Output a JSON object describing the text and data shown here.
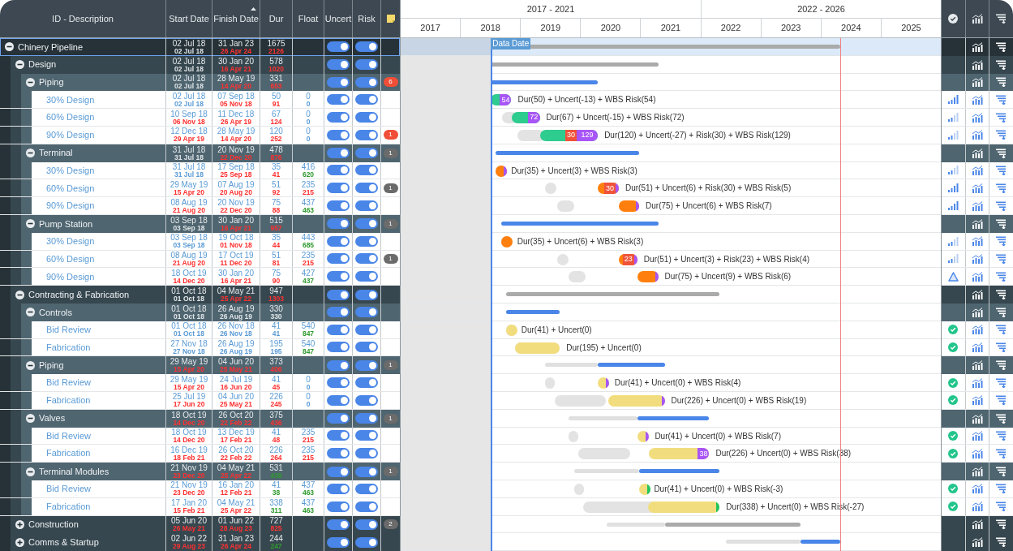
{
  "table": {
    "columns": [
      {
        "label": "ID - Description",
        "sorted": false
      },
      {
        "label": "Start Date",
        "sorted": false
      },
      {
        "label": "Finish Date",
        "sorted": true
      },
      {
        "label": "Dur",
        "sorted": false
      },
      {
        "label": "Float",
        "sorted": false
      },
      {
        "label": "Uncert",
        "sorted": false
      },
      {
        "label": "Risk",
        "sorted": false
      }
    ],
    "rows": [
      {
        "kind": "group",
        "name": "Chinery Pipeline",
        "expanded": true,
        "selected": true,
        "color": "#aaaaaa",
        "start": {
          "planned": "02 Jul 18",
          "risked": "02 Jul 18",
          "color": "#dfe5e8"
        },
        "finish": {
          "planned": "31 Jan 23",
          "risked": "26 Apr 24",
          "color": "#ff3030"
        },
        "dur": {
          "planned": "1675",
          "risked": "2126",
          "color": "#ff3030"
        },
        "uncert_on": true,
        "risk_on": true,
        "children": [
          {
            "kind": "group",
            "name": "Design",
            "expanded": true,
            "selected": false,
            "color": "#aaaaaa",
            "start": {
              "planned": "02 Jul 18",
              "risked": "02 Jul 18",
              "color": "#dfe5e8"
            },
            "finish": {
              "planned": "30 Jan 20",
              "risked": "16 Apr 21",
              "color": "#ff3030"
            },
            "dur": {
              "planned": "578",
              "risked": "1020",
              "color": "#ff3030"
            },
            "uncert_on": true,
            "risk_on": true,
            "children": [
              {
                "kind": "group",
                "name": "Piping",
                "expanded": true,
                "selected": false,
                "color": "#4a86e8",
                "start": {
                  "planned": "02 Jul 18",
                  "risked": "02 Jul 18",
                  "color": "#dfe5e8"
                },
                "finish": {
                  "planned": "28 May 19",
                  "risked": "14 Apr 20",
                  "color": "#ff3030"
                },
                "dur": {
                  "planned": "331",
                  "risked": "653",
                  "color": "#ff3030"
                },
                "uncert_on": true,
                "risk_on": true,
                "notes": {
                  "count": "6",
                  "urgent": true
                },
                "children": [
                  {
                    "kind": "task",
                    "name": "30% Design",
                    "selected": false,
                    "color": "#2ecc8f",
                    "start": {
                      "planned": "02 Jul 18",
                      "risked": "02 Jul 18",
                      "color": "#5b9bd5"
                    },
                    "finish": {
                      "planned": "07 Sep 18",
                      "risked": "05 Nov 18",
                      "color": "#ff3030"
                    },
                    "dur": {
                      "planned": "50",
                      "risked": "91",
                      "color": "#ff3030"
                    },
                    "float": {
                      "planned": "0",
                      "risked": "0",
                      "color": "#5b9bd5"
                    },
                    "uncert_on": true,
                    "risk_on": true,
                    "segments": [
                      {
                        "kind": "wbs_risk",
                        "label": "54"
                      }
                    ],
                    "annotation": "Dur(50) + Uncert(-13) + WBS Risk(54)",
                    "status": {
                      "kind": "signal",
                      "strong": true
                    }
                  },
                  {
                    "kind": "task",
                    "name": "60% Design",
                    "selected": false,
                    "color": "#2ecc8f",
                    "start": {
                      "planned": "10 Sep 18",
                      "risked": "06 Nov 18",
                      "color": "#ff3030"
                    },
                    "finish": {
                      "planned": "11 Dec 18",
                      "risked": "26 Apr 19",
                      "color": "#ff3030"
                    },
                    "dur": {
                      "planned": "67",
                      "risked": "124",
                      "color": "#ff3030"
                    },
                    "float": {
                      "planned": "0",
                      "risked": "0",
                      "color": "#5b9bd5"
                    },
                    "uncert_on": true,
                    "risk_on": true,
                    "segments": [
                      {
                        "kind": "wbs_risk",
                        "label": "72"
                      }
                    ],
                    "annotation": "Dur(67) + Uncert(-15) + WBS Risk(72)",
                    "status": {
                      "kind": "signal",
                      "strong": false
                    }
                  },
                  {
                    "kind": "task",
                    "name": "90% Design",
                    "selected": false,
                    "color": "#2ecc8f",
                    "start": {
                      "planned": "12 Dec 18",
                      "risked": "29 Apr 19",
                      "color": "#ff3030"
                    },
                    "finish": {
                      "planned": "28 May 19",
                      "risked": "14 Apr 20",
                      "color": "#ff3030"
                    },
                    "dur": {
                      "planned": "120",
                      "risked": "252",
                      "color": "#ff3030"
                    },
                    "float": {
                      "planned": "0",
                      "risked": "0",
                      "color": "#5b9bd5"
                    },
                    "uncert_on": true,
                    "risk_on": true,
                    "notes": {
                      "count": "1",
                      "urgent": true
                    },
                    "segments": [
                      {
                        "kind": "risk",
                        "label": "30"
                      },
                      {
                        "kind": "wbs_risk",
                        "label": "129"
                      }
                    ],
                    "annotation": "Dur(120) + Uncert(-27) + Risk(30) + WBS Risk(129)",
                    "status": {
                      "kind": "signal",
                      "strong": false
                    }
                  }
                ]
              },
              {
                "kind": "group",
                "name": "Terminal",
                "expanded": true,
                "selected": false,
                "color": "#4a86e8",
                "start": {
                  "planned": "31 Jul 18",
                  "risked": "31 Jul 18",
                  "color": "#dfe5e8"
                },
                "finish": {
                  "planned": "20 Nov 19",
                  "risked": "22 Dec 20",
                  "color": "#ff3030"
                },
                "dur": {
                  "planned": "478",
                  "risked": "876",
                  "color": "#ff3030"
                },
                "uncert_on": true,
                "risk_on": true,
                "notes": {
                  "count": "1",
                  "urgent": false
                },
                "children": [
                  {
                    "kind": "task",
                    "name": "30% Design",
                    "selected": false,
                    "color": "#ff7f0e",
                    "start": {
                      "planned": "31 Jul 18",
                      "risked": "31 Jul 18",
                      "color": "#5b9bd5"
                    },
                    "finish": {
                      "planned": "17 Sep 18",
                      "risked": "25 Sep 18",
                      "color": "#ff3030"
                    },
                    "dur": {
                      "planned": "35",
                      "risked": "41",
                      "color": "#ff3030"
                    },
                    "float": {
                      "planned": "416",
                      "risked": "620",
                      "color": "#2f9a2f"
                    },
                    "uncert_on": true,
                    "risk_on": true,
                    "segments": [
                      {
                        "kind": "wbs_risk"
                      }
                    ],
                    "annotation": "Dur(35) + Uncert(3) + WBS Risk(3)",
                    "status": {
                      "kind": "signal",
                      "strong": false
                    }
                  },
                  {
                    "kind": "task",
                    "name": "60% Design",
                    "selected": false,
                    "color": "#ff7f0e",
                    "start": {
                      "planned": "29 May 19",
                      "risked": "15 Apr 20",
                      "color": "#ff3030"
                    },
                    "finish": {
                      "planned": "07 Aug 19",
                      "risked": "20 Aug 20",
                      "color": "#ff3030"
                    },
                    "dur": {
                      "planned": "51",
                      "risked": "92",
                      "color": "#ff3030"
                    },
                    "float": {
                      "planned": "235",
                      "risked": "215",
                      "color": "#ff3030"
                    },
                    "uncert_on": true,
                    "risk_on": true,
                    "notes": {
                      "count": "1",
                      "urgent": false
                    },
                    "segments": [
                      {
                        "kind": "risk",
                        "label": "30"
                      },
                      {
                        "kind": "wbs_risk"
                      }
                    ],
                    "annotation": "Dur(51) + Uncert(6) + Risk(30) + WBS Risk(5)",
                    "status": {
                      "kind": "signal",
                      "strong": true
                    }
                  },
                  {
                    "kind": "task",
                    "name": "90% Design",
                    "selected": false,
                    "color": "#ff7f0e",
                    "start": {
                      "planned": "08 Aug 19",
                      "risked": "21 Aug 20",
                      "color": "#ff3030"
                    },
                    "finish": {
                      "planned": "20 Nov 19",
                      "risked": "22 Dec 20",
                      "color": "#ff3030"
                    },
                    "dur": {
                      "planned": "75",
                      "risked": "88",
                      "color": "#ff3030"
                    },
                    "float": {
                      "planned": "437",
                      "risked": "463",
                      "color": "#2f9a2f"
                    },
                    "uncert_on": true,
                    "risk_on": true,
                    "segments": [
                      {
                        "kind": "wbs_risk"
                      }
                    ],
                    "annotation": "Dur(75) + Uncert(6) + WBS Risk(7)",
                    "status": {
                      "kind": "signal",
                      "strong": true
                    }
                  }
                ]
              },
              {
                "kind": "group",
                "name": "Pump Station",
                "expanded": true,
                "selected": false,
                "color": "#4a86e8",
                "start": {
                  "planned": "03 Sep 18",
                  "risked": "03 Sep 18",
                  "color": "#dfe5e8"
                },
                "finish": {
                  "planned": "30 Jan 20",
                  "risked": "16 Apr 21",
                  "color": "#ff3030"
                },
                "dur": {
                  "planned": "515",
                  "risked": "957",
                  "color": "#ff3030"
                },
                "uncert_on": true,
                "risk_on": true,
                "notes": {
                  "count": "1",
                  "urgent": false
                },
                "children": [
                  {
                    "kind": "task",
                    "name": "30% Design",
                    "selected": false,
                    "color": "#ff7f0e",
                    "start": {
                      "planned": "03 Sep 18",
                      "risked": "03 Sep 18",
                      "color": "#5b9bd5"
                    },
                    "finish": {
                      "planned": "19 Oct 18",
                      "risked": "01 Nov 18",
                      "color": "#ff3030"
                    },
                    "dur": {
                      "planned": "35",
                      "risked": "44",
                      "color": "#ff3030"
                    },
                    "float": {
                      "planned": "443",
                      "risked": "685",
                      "color": "#2f9a2f"
                    },
                    "uncert_on": true,
                    "risk_on": true,
                    "annotation": "Dur(35) + Uncert(6) + WBS Risk(3)",
                    "status": {
                      "kind": "signal",
                      "strong": false
                    }
                  },
                  {
                    "kind": "task",
                    "name": "60% Design",
                    "selected": false,
                    "color": "#ff7f0e",
                    "start": {
                      "planned": "08 Aug 19",
                      "risked": "21 Aug 20",
                      "color": "#ff3030"
                    },
                    "finish": {
                      "planned": "17 Oct 19",
                      "risked": "11 Dec 20",
                      "color": "#ff3030"
                    },
                    "dur": {
                      "planned": "51",
                      "risked": "81",
                      "color": "#ff3030"
                    },
                    "float": {
                      "planned": "235",
                      "risked": "215",
                      "color": "#ff3030"
                    },
                    "uncert_on": true,
                    "risk_on": true,
                    "notes": {
                      "count": "1",
                      "urgent": false
                    },
                    "segments": [
                      {
                        "kind": "risk",
                        "label": "23"
                      },
                      {
                        "kind": "wbs_risk"
                      }
                    ],
                    "annotation": "Dur(51) + Uncert(3) + Risk(23) + WBS Risk(4)",
                    "status": {
                      "kind": "signal",
                      "strong": false
                    }
                  },
                  {
                    "kind": "task",
                    "name": "90% Design",
                    "selected": false,
                    "color": "#ff7f0e",
                    "start": {
                      "planned": "18 Oct 19",
                      "risked": "14 Dec 20",
                      "color": "#ff3030"
                    },
                    "finish": {
                      "planned": "30 Jan 20",
                      "risked": "16 Apr 21",
                      "color": "#ff3030"
                    },
                    "dur": {
                      "planned": "75",
                      "risked": "90",
                      "color": "#ff3030"
                    },
                    "float": {
                      "planned": "427",
                      "risked": "437",
                      "color": "#2f9a2f"
                    },
                    "uncert_on": true,
                    "risk_on": true,
                    "segments": [
                      {
                        "kind": "wbs_risk"
                      }
                    ],
                    "annotation": "Dur(75) + Uncert(9) + WBS Risk(6)",
                    "status": {
                      "kind": "warning"
                    }
                  }
                ]
              }
            ]
          },
          {
            "kind": "group",
            "name": "Contracting & Fabrication",
            "expanded": true,
            "selected": false,
            "color": "#aaaaaa",
            "start": {
              "planned": "01 Oct 18",
              "risked": "01 Oct 18",
              "color": "#dfe5e8"
            },
            "finish": {
              "planned": "04 May 21",
              "risked": "25 Apr 22",
              "color": "#ff3030"
            },
            "dur": {
              "planned": "947",
              "risked": "1303",
              "color": "#ff3030"
            },
            "uncert_on": true,
            "risk_on": true,
            "children": [
              {
                "kind": "group",
                "name": "Controls",
                "expanded": true,
                "selected": false,
                "color": "#4a86e8",
                "start": {
                  "planned": "01 Oct 18",
                  "risked": "01 Oct 18",
                  "color": "#dfe5e8"
                },
                "finish": {
                  "planned": "26 Aug 19",
                  "risked": "26 Aug 19",
                  "color": "#dfe5e8"
                },
                "dur": {
                  "planned": "330",
                  "risked": "330",
                  "color": "#dfe5e8"
                },
                "uncert_on": true,
                "risk_on": true,
                "children": [
                  {
                    "kind": "task",
                    "name": "Bid Review",
                    "selected": false,
                    "color": "#f2dd7e",
                    "start": {
                      "planned": "01 Oct 18",
                      "risked": "01 Oct 18",
                      "color": "#5b9bd5"
                    },
                    "finish": {
                      "planned": "26 Nov 18",
                      "risked": "26 Nov 18",
                      "color": "#5b9bd5"
                    },
                    "dur": {
                      "planned": "41",
                      "risked": "41",
                      "color": "#5b9bd5"
                    },
                    "float": {
                      "planned": "540",
                      "risked": "847",
                      "color": "#2f9a2f"
                    },
                    "uncert_on": true,
                    "risk_on": true,
                    "annotation": "Dur(41) + Uncert(0)",
                    "status": {
                      "kind": "ok"
                    }
                  },
                  {
                    "kind": "task",
                    "name": "Fabrication",
                    "selected": false,
                    "color": "#f2dd7e",
                    "start": {
                      "planned": "27 Nov 18",
                      "risked": "27 Nov 18",
                      "color": "#5b9bd5"
                    },
                    "finish": {
                      "planned": "26 Aug 19",
                      "risked": "26 Aug 19",
                      "color": "#5b9bd5"
                    },
                    "dur": {
                      "planned": "195",
                      "risked": "195",
                      "color": "#5b9bd5"
                    },
                    "float": {
                      "planned": "540",
                      "risked": "847",
                      "color": "#2f9a2f"
                    },
                    "uncert_on": true,
                    "risk_on": true,
                    "annotation": "Dur(195) + Uncert(0)",
                    "status": {
                      "kind": "ok"
                    }
                  }
                ]
              },
              {
                "kind": "group",
                "name": "Piping",
                "expanded": true,
                "selected": false,
                "color": "#4a86e8",
                "start": {
                  "planned": "29 May 19",
                  "risked": "15 Apr 20",
                  "color": "#ff3030"
                },
                "finish": {
                  "planned": "04 Jun 20",
                  "risked": "25 May 21",
                  "color": "#ff3030"
                },
                "dur": {
                  "planned": "373",
                  "risked": "406",
                  "color": "#ff3030"
                },
                "uncert_on": true,
                "risk_on": true,
                "notes": {
                  "count": "1",
                  "urgent": false
                },
                "children": [
                  {
                    "kind": "task",
                    "name": "Bid Review",
                    "selected": false,
                    "color": "#f2dd7e",
                    "start": {
                      "planned": "29 May 19",
                      "risked": "15 Apr 20",
                      "color": "#ff3030"
                    },
                    "finish": {
                      "planned": "24 Jul 19",
                      "risked": "16 Jun 20",
                      "color": "#ff3030"
                    },
                    "dur": {
                      "planned": "41",
                      "risked": "45",
                      "color": "#ff3030"
                    },
                    "float": {
                      "planned": "0",
                      "risked": "0",
                      "color": "#5b9bd5"
                    },
                    "uncert_on": true,
                    "risk_on": true,
                    "segments": [
                      {
                        "kind": "wbs_risk"
                      }
                    ],
                    "annotation": "Dur(41) + Uncert(0) + WBS Risk(4)",
                    "status": {
                      "kind": "ok"
                    }
                  },
                  {
                    "kind": "task",
                    "name": "Fabrication",
                    "selected": false,
                    "color": "#f2dd7e",
                    "start": {
                      "planned": "25 Jul 19",
                      "risked": "17 Jun 20",
                      "color": "#ff3030"
                    },
                    "finish": {
                      "planned": "04 Jun 20",
                      "risked": "25 May 21",
                      "color": "#ff3030"
                    },
                    "dur": {
                      "planned": "226",
                      "risked": "245",
                      "color": "#ff3030"
                    },
                    "float": {
                      "planned": "0",
                      "risked": "0",
                      "color": "#5b9bd5"
                    },
                    "uncert_on": true,
                    "risk_on": true,
                    "segments": [
                      {
                        "kind": "wbs_risk"
                      }
                    ],
                    "annotation": "Dur(226) + Uncert(0) + WBS Risk(19)",
                    "status": {
                      "kind": "ok"
                    }
                  }
                ]
              },
              {
                "kind": "group",
                "name": "Valves",
                "expanded": true,
                "selected": false,
                "color": "#4a86e8",
                "start": {
                  "planned": "18 Oct 19",
                  "risked": "14 Dec 20",
                  "color": "#ff3030"
                },
                "finish": {
                  "planned": "26 Oct 20",
                  "risked": "22 Feb 22",
                  "color": "#ff3030"
                },
                "dur": {
                  "planned": "375",
                  "risked": "436",
                  "color": "#ff3030"
                },
                "uncert_on": true,
                "risk_on": true,
                "notes": {
                  "count": "1",
                  "urgent": false
                },
                "children": [
                  {
                    "kind": "task",
                    "name": "Bid Review",
                    "selected": false,
                    "color": "#f2dd7e",
                    "start": {
                      "planned": "18 Oct 19",
                      "risked": "14 Dec 20",
                      "color": "#ff3030"
                    },
                    "finish": {
                      "planned": "13 Dec 19",
                      "risked": "17 Feb 21",
                      "color": "#ff3030"
                    },
                    "dur": {
                      "planned": "41",
                      "risked": "48",
                      "color": "#ff3030"
                    },
                    "float": {
                      "planned": "235",
                      "risked": "215",
                      "color": "#ff3030"
                    },
                    "uncert_on": true,
                    "risk_on": true,
                    "segments": [
                      {
                        "kind": "wbs_risk"
                      }
                    ],
                    "annotation": "Dur(41) + Uncert(0) + WBS Risk(7)",
                    "status": {
                      "kind": "ok"
                    }
                  },
                  {
                    "kind": "task",
                    "name": "Fabrication",
                    "selected": false,
                    "color": "#f2dd7e",
                    "start": {
                      "planned": "16 Dec 19",
                      "risked": "18 Feb 21",
                      "color": "#ff3030"
                    },
                    "finish": {
                      "planned": "26 Oct 20",
                      "risked": "22 Feb 22",
                      "color": "#ff3030"
                    },
                    "dur": {
                      "planned": "226",
                      "risked": "264",
                      "color": "#ff3030"
                    },
                    "float": {
                      "planned": "235",
                      "risked": "215",
                      "color": "#ff3030"
                    },
                    "uncert_on": true,
                    "risk_on": true,
                    "segments": [
                      {
                        "kind": "wbs_risk",
                        "label": "38"
                      }
                    ],
                    "annotation": "Dur(226) + Uncert(0) + WBS Risk(38)",
                    "status": {
                      "kind": "ok"
                    }
                  }
                ]
              },
              {
                "kind": "group",
                "name": "Terminal Modules",
                "expanded": true,
                "selected": false,
                "color": "#4a86e8",
                "start": {
                  "planned": "21 Nov 19",
                  "risked": "23 Dec 20",
                  "color": "#ff3030"
                },
                "finish": {
                  "planned": "04 May 21",
                  "risked": "25 Apr 22",
                  "color": "#ff3030"
                },
                "dur": {
                  "planned": "531",
                  "risked": "439",
                  "color": "#2f9a2f"
                },
                "uncert_on": true,
                "risk_on": true,
                "notes": {
                  "count": "1",
                  "urgent": false
                },
                "children": [
                  {
                    "kind": "task",
                    "name": "Bid Review",
                    "selected": false,
                    "color": "#f2dd7e",
                    "start": {
                      "planned": "21 Nov 19",
                      "risked": "23 Dec 20",
                      "color": "#ff3030"
                    },
                    "finish": {
                      "planned": "16 Jan 20",
                      "risked": "12 Feb 21",
                      "color": "#ff3030"
                    },
                    "dur": {
                      "planned": "41",
                      "risked": "38",
                      "color": "#2f9a2f"
                    },
                    "float": {
                      "planned": "437",
                      "risked": "463",
                      "color": "#2f9a2f"
                    },
                    "uncert_on": true,
                    "risk_on": true,
                    "segments": [
                      {
                        "kind": "wbs_credit"
                      }
                    ],
                    "annotation": "Dur(41) + Uncert(0) + WBS Risk(-3)",
                    "status": {
                      "kind": "ok"
                    }
                  },
                  {
                    "kind": "task",
                    "name": "Fabrication",
                    "selected": false,
                    "color": "#f2dd7e",
                    "start": {
                      "planned": "17 Jan 20",
                      "risked": "15 Feb 21",
                      "color": "#ff3030"
                    },
                    "finish": {
                      "planned": "04 May 21",
                      "risked": "25 Apr 22",
                      "color": "#ff3030"
                    },
                    "dur": {
                      "planned": "338",
                      "risked": "311",
                      "color": "#2f9a2f"
                    },
                    "float": {
                      "planned": "437",
                      "risked": "463",
                      "color": "#2f9a2f"
                    },
                    "uncert_on": true,
                    "risk_on": true,
                    "segments": [
                      {
                        "kind": "wbs_credit"
                      }
                    ],
                    "annotation": "Dur(338) + Uncert(0) + WBS Risk(-27)",
                    "status": {
                      "kind": "ok"
                    }
                  }
                ]
              }
            ]
          },
          {
            "kind": "group",
            "name": "Construction",
            "expanded": false,
            "selected": false,
            "color": "#aaaaaa",
            "start": {
              "planned": "05 Jun 20",
              "risked": "26 May 21",
              "color": "#ff3030"
            },
            "finish": {
              "planned": "01 Jun 22",
              "risked": "28 Aug 23",
              "color": "#ff3030"
            },
            "dur": {
              "planned": "727",
              "risked": "825",
              "color": "#ff3030"
            },
            "uncert_on": true,
            "risk_on": true,
            "notes": {
              "count": "2",
              "urgent": false
            }
          },
          {
            "kind": "group",
            "name": "Comms & Startup",
            "expanded": false,
            "selected": false,
            "color": "#4a86e8",
            "start": {
              "planned": "02 Jun 22",
              "risked": "29 Aug 23",
              "color": "#ff3030"
            },
            "finish": {
              "planned": "31 Jan 23",
              "risked": "26 Apr 24",
              "color": "#ff3030"
            },
            "dur": {
              "planned": "244",
              "risked": "247",
              "color": "#2f9a2f"
            },
            "uncert_on": true,
            "risk_on": true
          }
        ]
      }
    ]
  },
  "gantt": {
    "periods": [
      "2017 - 2021",
      "2022 - 2026"
    ],
    "years": [
      "2017",
      "2018",
      "2019",
      "2020",
      "2021",
      "2022",
      "2023",
      "2024",
      "2025"
    ],
    "data_date": {
      "label": "Data Date"
    }
  }
}
